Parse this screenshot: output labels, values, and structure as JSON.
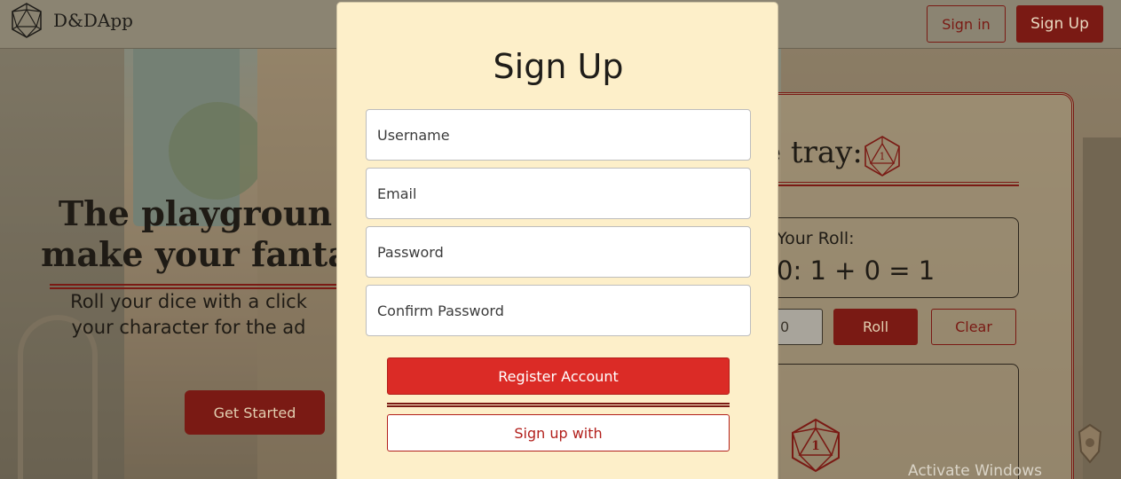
{
  "nav": {
    "brand": "D&DApp",
    "sign_in_label": "Sign in",
    "sign_up_label": "Sign Up"
  },
  "hero": {
    "title_line1": "The playgroun",
    "title_line2": "make your fanta",
    "subtitle_line1": "Roll your dice with a click",
    "subtitle_line2": "your character for the ad",
    "cta_label": "Get Started"
  },
  "dice_tray": {
    "title": "e tray:",
    "d20_face": "1",
    "roll_label": "Your Roll:",
    "roll_result": "0: 1 + 0 = 1",
    "input_value": "0",
    "roll_button": "Roll",
    "clear_button": "Clear"
  },
  "modal": {
    "title": "Sign Up",
    "fields": {
      "username_placeholder": "Username",
      "email_placeholder": "Email",
      "password_placeholder": "Password",
      "confirm_password_placeholder": "Confirm Password"
    },
    "register_label": "Register Account",
    "oauth_label": "Sign up with"
  },
  "watermark": "Activate Windows",
  "colors": {
    "accent_dark_red": "#7a1a14",
    "register_red": "#db2b26",
    "modal_bg": "#fdefc9"
  }
}
